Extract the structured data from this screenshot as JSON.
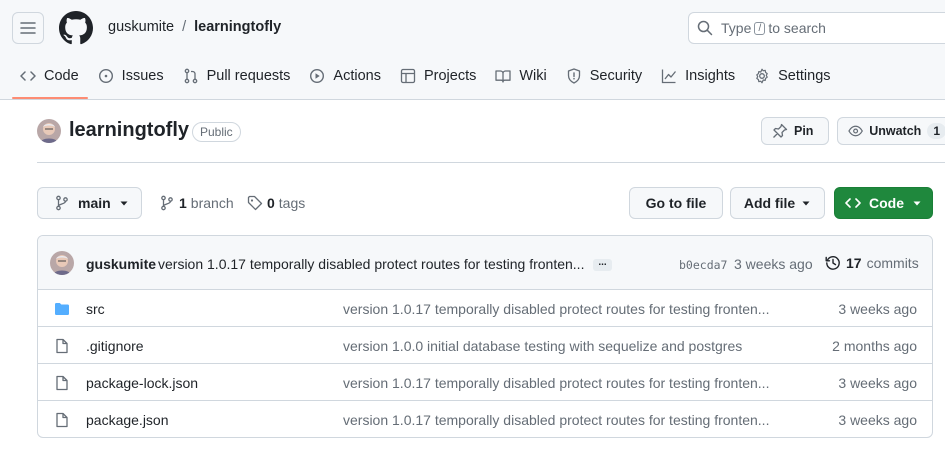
{
  "header": {
    "owner": "guskumite",
    "separator": "/",
    "repo": "learningtofly",
    "search_prefix": "Type",
    "search_key": "/",
    "search_suffix": "to search"
  },
  "tabs": [
    {
      "label": "Code",
      "icon": "code-icon",
      "active": true
    },
    {
      "label": "Issues",
      "icon": "issue-icon"
    },
    {
      "label": "Pull requests",
      "icon": "pull-request-icon"
    },
    {
      "label": "Actions",
      "icon": "play-icon"
    },
    {
      "label": "Projects",
      "icon": "table-icon"
    },
    {
      "label": "Wiki",
      "icon": "book-icon"
    },
    {
      "label": "Security",
      "icon": "shield-icon"
    },
    {
      "label": "Insights",
      "icon": "graph-icon"
    },
    {
      "label": "Settings",
      "icon": "gear-icon"
    }
  ],
  "repo_header": {
    "name": "learningtofly",
    "visibility": "Public",
    "pin_label": "Pin",
    "unwatch_label": "Unwatch",
    "watch_count": "1"
  },
  "branch_bar": {
    "branch": "main",
    "branch_count": "1",
    "branch_word": "branch",
    "tag_count": "0",
    "tag_word": "tags",
    "go_to_file": "Go to file",
    "add_file": "Add file",
    "code": "Code"
  },
  "latest_commit": {
    "author": "guskumite",
    "message": "version 1.0.17 temporally disabled protect routes for testing fronten...",
    "ellipsis": "...",
    "sha": "b0ecda7",
    "age": "3 weeks ago",
    "commit_count": "17",
    "commit_word": "commits"
  },
  "files": [
    {
      "name": "src",
      "type": "folder",
      "message": "version 1.0.17 temporally disabled protect routes for testing fronten...",
      "age": "3 weeks ago"
    },
    {
      "name": ".gitignore",
      "type": "file",
      "message": "version 1.0.0 initial database testing with sequelize and postgres",
      "age": "2 months ago"
    },
    {
      "name": "package-lock.json",
      "type": "file",
      "message": "version 1.0.17 temporally disabled protect routes for testing fronten...",
      "age": "3 weeks ago"
    },
    {
      "name": "package.json",
      "type": "file",
      "message": "version 1.0.17 temporally disabled protect routes for testing fronten...",
      "age": "3 weeks ago"
    }
  ],
  "colors": {
    "accent_underline": "#fd8c73",
    "primary_green": "#1f883d",
    "folder_blue": "#54aeff"
  }
}
